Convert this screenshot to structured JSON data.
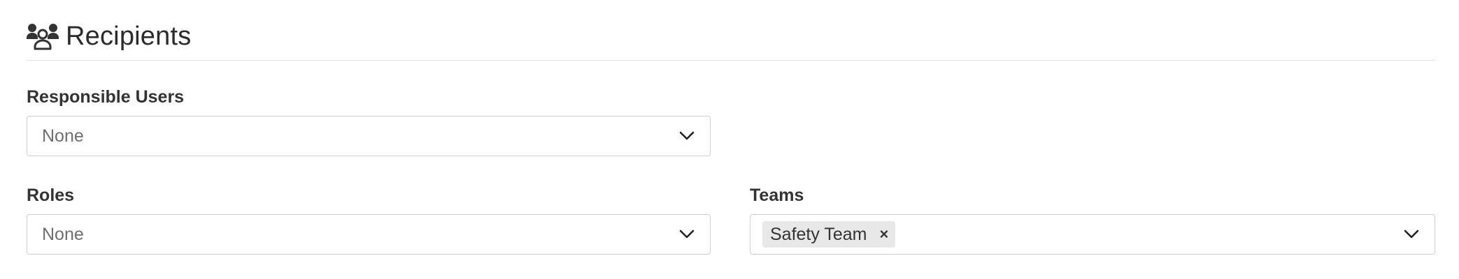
{
  "section": {
    "title": "Recipients",
    "icon": "users-icon"
  },
  "fields": {
    "responsible_users": {
      "label": "Responsible Users",
      "value": "None"
    },
    "roles": {
      "label": "Roles",
      "value": "None"
    },
    "teams": {
      "label": "Teams",
      "selected": [
        "Safety Team"
      ],
      "remove_glyph": "×"
    }
  }
}
